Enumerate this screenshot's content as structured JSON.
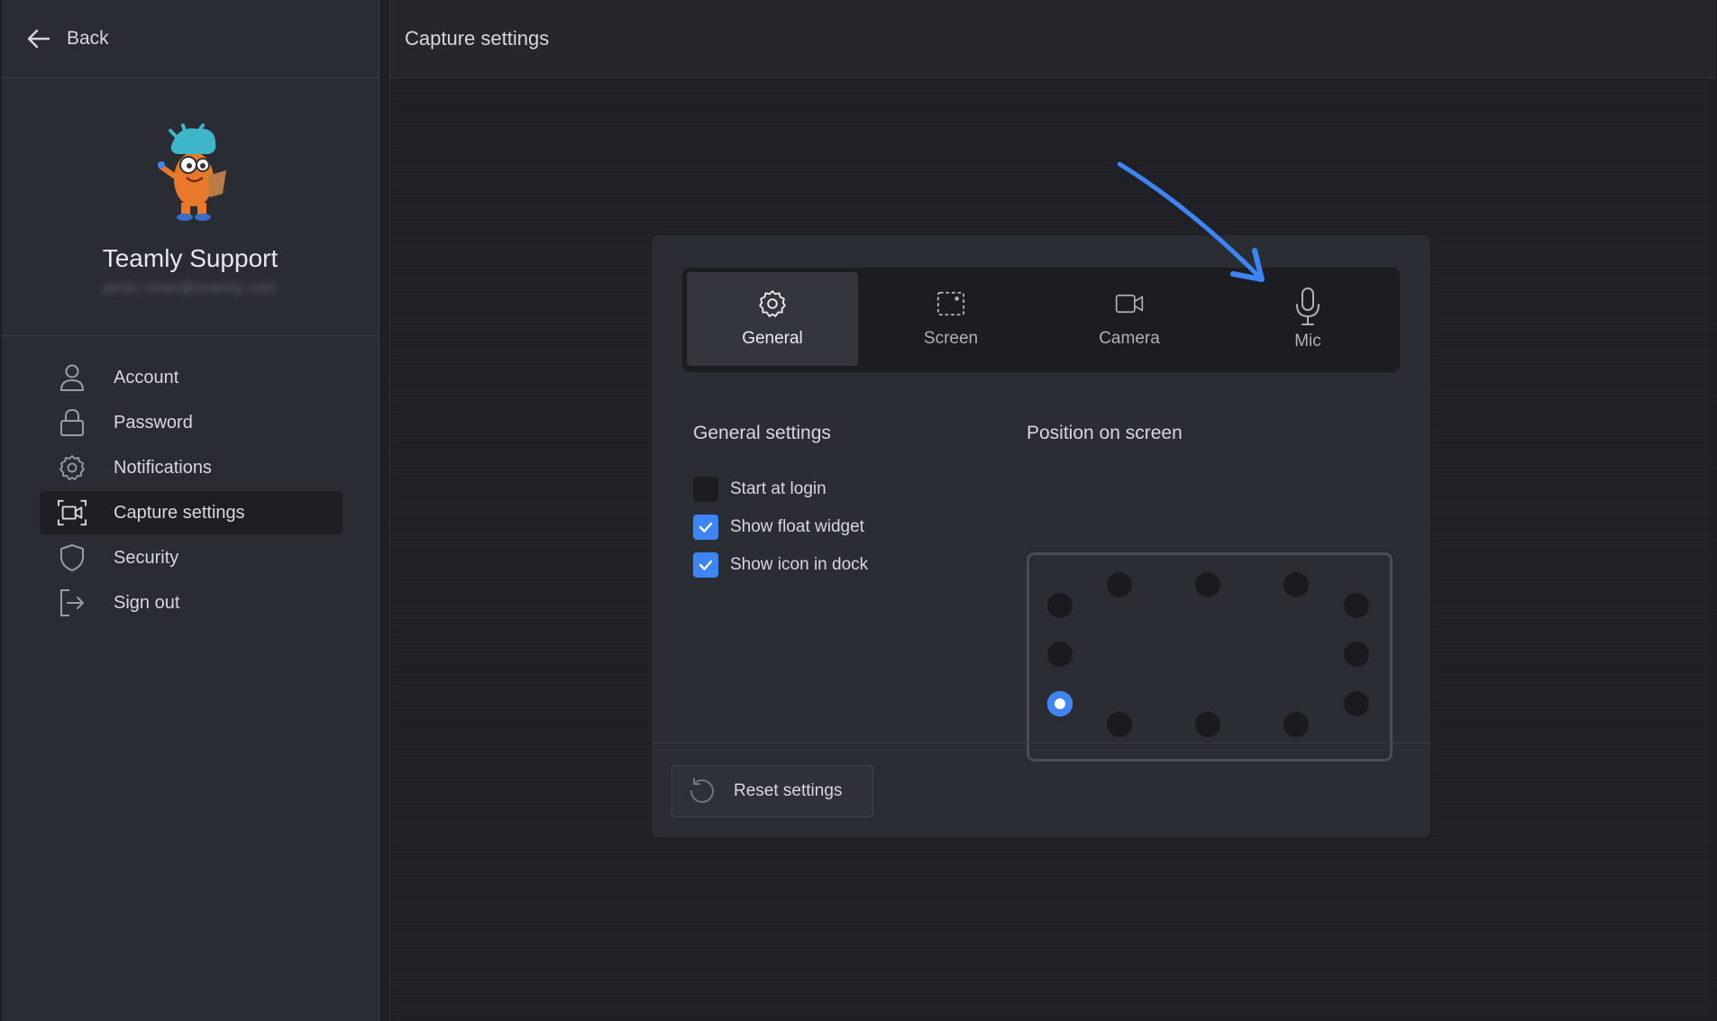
{
  "sidebar": {
    "back_label": "Back",
    "profile": {
      "name": "Teamly Support",
      "email": "peter.chao@teamly.com"
    },
    "items": [
      {
        "label": "Account",
        "icon": "user-icon"
      },
      {
        "label": "Password",
        "icon": "lock-icon"
      },
      {
        "label": "Notifications",
        "icon": "gear-icon"
      },
      {
        "label": "Capture settings",
        "icon": "capture-icon",
        "active": true
      },
      {
        "label": "Security",
        "icon": "shield-icon"
      },
      {
        "label": "Sign out",
        "icon": "sign-out-icon"
      }
    ]
  },
  "main": {
    "title": "Capture settings",
    "tabs": [
      {
        "label": "General",
        "icon": "gear-icon",
        "active": true
      },
      {
        "label": "Screen",
        "icon": "screen-select-icon"
      },
      {
        "label": "Camera",
        "icon": "camera-icon"
      },
      {
        "label": "Mic",
        "icon": "mic-icon"
      }
    ],
    "general": {
      "title": "General settings",
      "options": [
        {
          "label": "Start at login",
          "checked": false
        },
        {
          "label": "Show float widget",
          "checked": true
        },
        {
          "label": "Show icon in dock",
          "checked": true
        }
      ]
    },
    "position": {
      "title": "Position on screen",
      "selected": "left-bottom"
    },
    "reset_label": "Reset settings"
  },
  "colors": {
    "accent": "#3d84f5",
    "background": "#1f2025",
    "panel": "#2b2d34",
    "sidebar": "#2a2c33"
  }
}
